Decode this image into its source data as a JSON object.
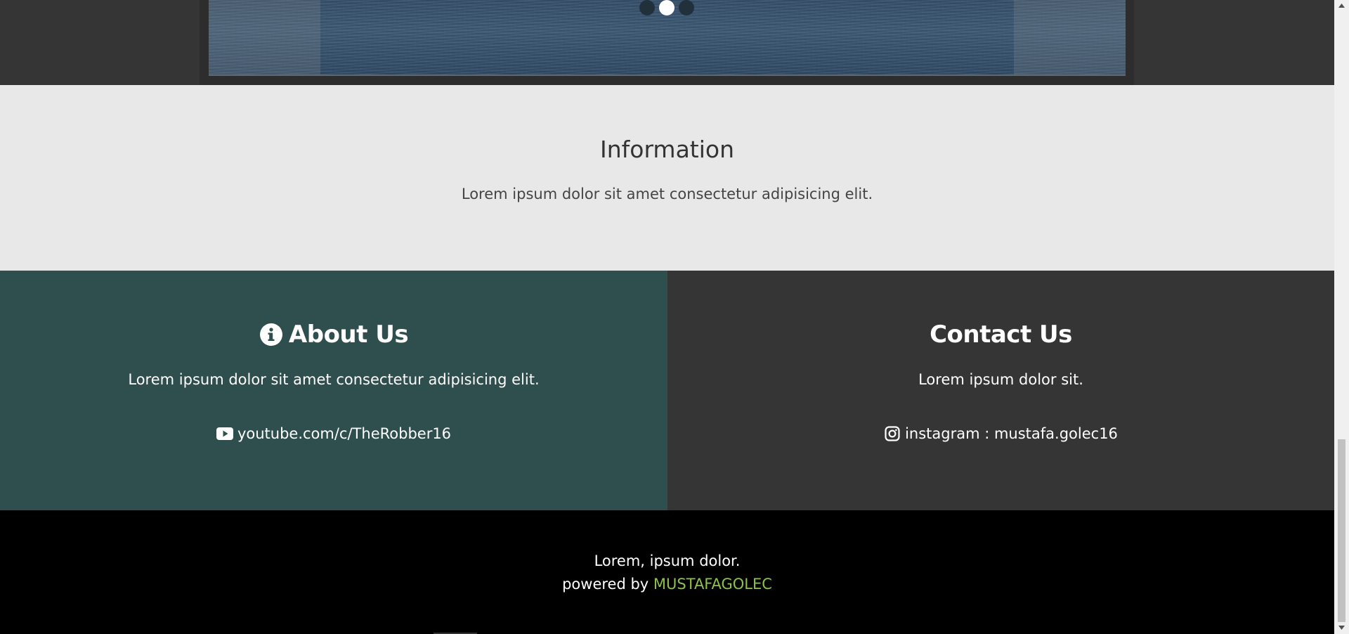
{
  "slider": {
    "active_index": 2,
    "dot_count": 3
  },
  "information": {
    "title": "Information",
    "text": "Lorem ipsum dolor sit amet consectetur adipisicing elit."
  },
  "about": {
    "title": "About Us",
    "icon": "info-circle-icon",
    "text": "Lorem ipsum dolor sit amet consectetur adipisicing elit.",
    "link_icon": "youtube-icon",
    "link_text": "youtube.com/c/TheRobber16",
    "background": "#2f4f4f"
  },
  "contact": {
    "title": "Contact Us",
    "text": "Lorem ipsum dolor sit.",
    "link_icon": "instagram-icon",
    "link_text": "instagram : mustafa.golec16",
    "background": "#353535"
  },
  "footer": {
    "line1": "Lorem, ipsum dolor.",
    "powered_by": "powered by",
    "brand": "MUSTAFAGOLEC",
    "brand_color": "#8bc34a"
  }
}
